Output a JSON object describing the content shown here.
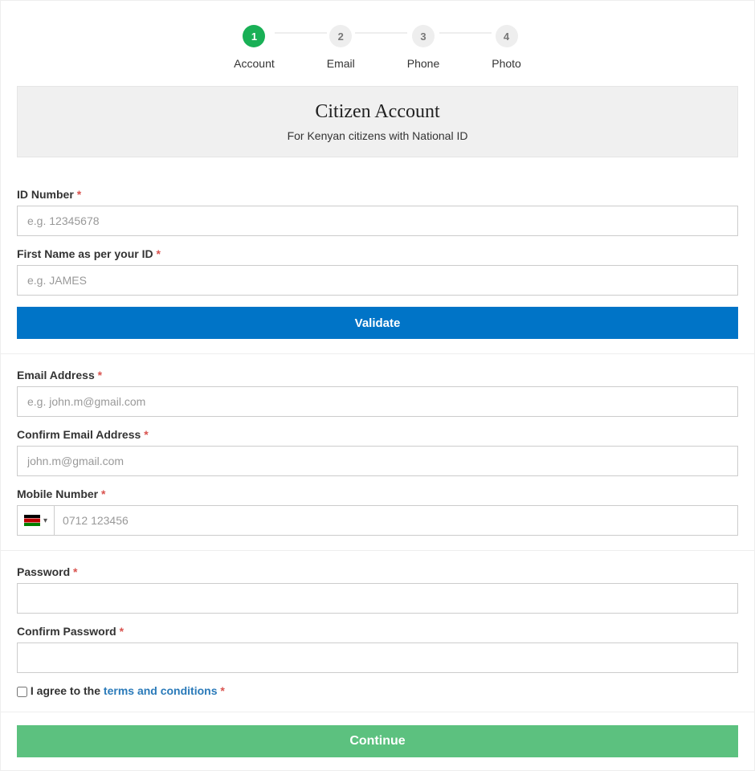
{
  "stepper": {
    "steps": [
      {
        "number": "1",
        "label": "Account",
        "active": true
      },
      {
        "number": "2",
        "label": "Email",
        "active": false
      },
      {
        "number": "3",
        "label": "Phone",
        "active": false
      },
      {
        "number": "4",
        "label": "Photo",
        "active": false
      }
    ]
  },
  "header": {
    "title": "Citizen Account",
    "subtitle": "For Kenyan citizens with National ID"
  },
  "required_mark": "*",
  "section_id": {
    "id_number": {
      "label": "ID Number ",
      "placeholder": "e.g. 12345678"
    },
    "first_name": {
      "label": "First Name as per your ID ",
      "placeholder": "e.g. JAMES"
    },
    "validate_button": "Validate"
  },
  "section_contact": {
    "email": {
      "label": "Email Address ",
      "placeholder": "e.g. john.m@gmail.com"
    },
    "confirm_email": {
      "label": "Confirm Email Address ",
      "placeholder": "john.m@gmail.com"
    },
    "mobile": {
      "label": "Mobile Number ",
      "placeholder": "0712 123456",
      "country": "KE"
    }
  },
  "section_pw": {
    "password": {
      "label": "Password "
    },
    "confirm_password": {
      "label": "Confirm Password "
    },
    "agree_prefix": " I agree to the ",
    "terms_link": "terms and conditions ",
    "agree_suffix": ""
  },
  "footer": {
    "continue_button": "Continue"
  }
}
